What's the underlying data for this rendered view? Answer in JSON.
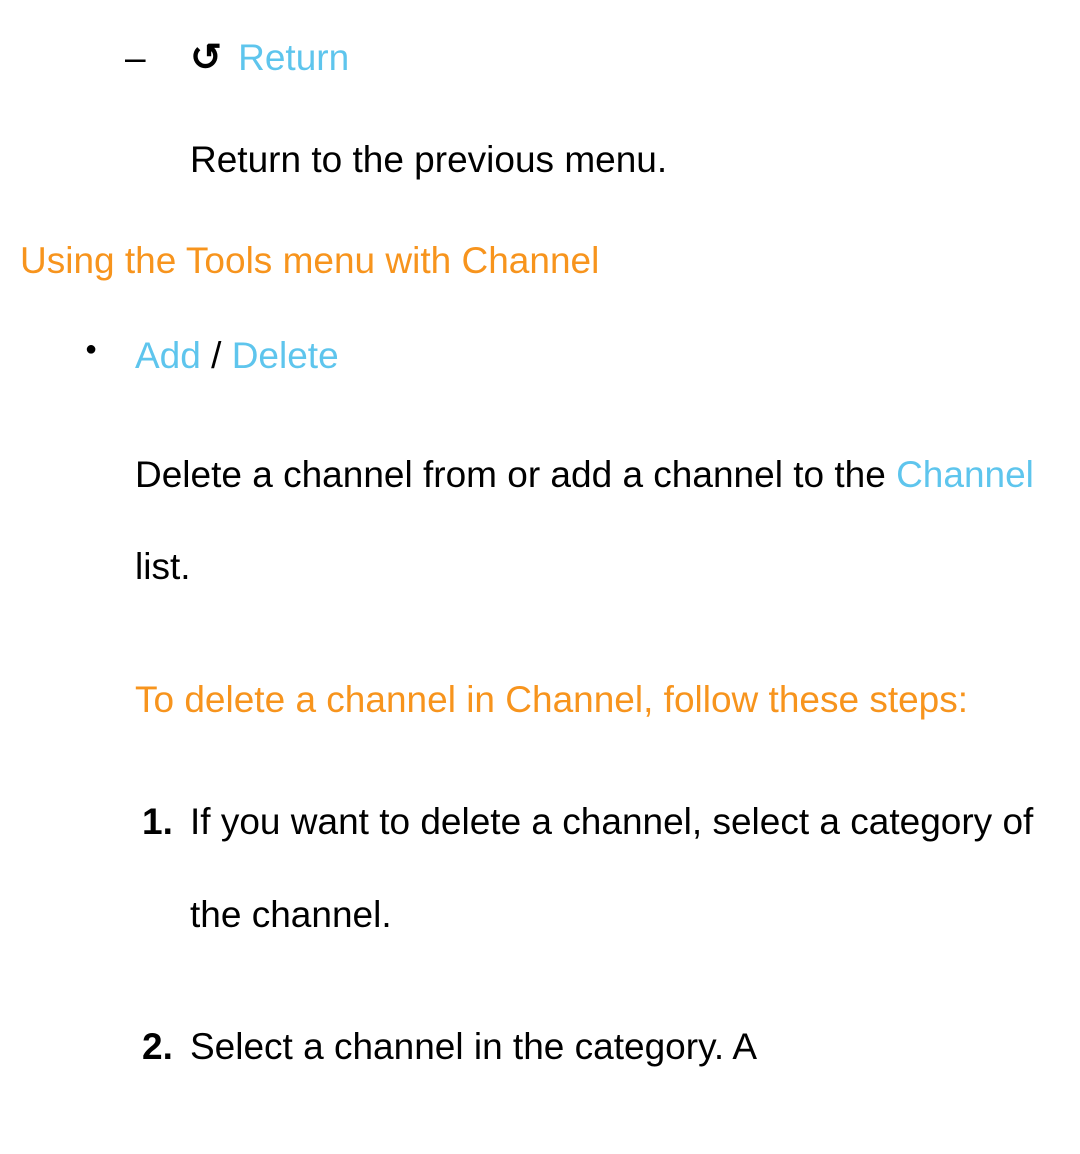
{
  "return_section": {
    "icon_name": "return-icon",
    "label": "Return",
    "description": "Return to the previous menu."
  },
  "heading": "Using the Tools menu with Channel",
  "add_delete": {
    "add_label": "Add",
    "separator": " / ",
    "delete_label": "Delete",
    "desc_part1": "Delete a channel from or add a channel to the ",
    "desc_channel": "Channel",
    "desc_part2": " list."
  },
  "subheading": "To delete a channel in Channel, follow these steps:",
  "steps": [
    {
      "num": "1.",
      "text": "If you want to delete a channel, select a category of the channel."
    },
    {
      "num": "2.",
      "text": "Select a channel in the category. A"
    }
  ]
}
